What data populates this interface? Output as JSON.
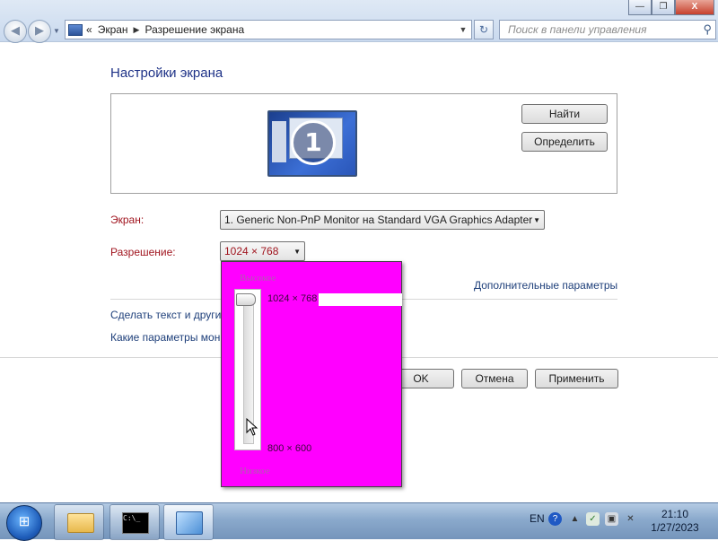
{
  "window": {
    "controls": {
      "minimize": "—",
      "maximize": "❐",
      "close": "X"
    }
  },
  "address_bar": {
    "prefix": "«",
    "crumbs": [
      "Экран",
      "Разрешение экрана"
    ],
    "search_placeholder": "Поиск в панели управления"
  },
  "page": {
    "title": "Настройки экрана",
    "monitor_number": "1",
    "find_button": "Найти",
    "identify_button": "Определить",
    "display_label": "Экран:",
    "display_value": "1. Generic Non-PnP Monitor на Standard VGA Graphics Adapter",
    "resolution_label": "Разрешение:",
    "resolution_value": "1024 × 768",
    "advanced_link": "Дополнительные параметры",
    "link_text_size": "Сделать текст и други",
    "link_which_params": "Какие параметры мон",
    "ok_button": "OK",
    "cancel_button": "Отмена",
    "apply_button": "Применить"
  },
  "resolution_popup": {
    "high_label": "Высокое",
    "low_label": "Низкое",
    "top_option": "1024 × 768",
    "bottom_option": "800 × 600",
    "slider_level": 1.0,
    "background_color": "#ff00ff"
  },
  "taskbar": {
    "language": "EN",
    "time": "21:10",
    "date": "1/27/2023",
    "apps": [
      "explorer-folder-icon",
      "command-prompt-icon",
      "control-panel-icon"
    ]
  }
}
